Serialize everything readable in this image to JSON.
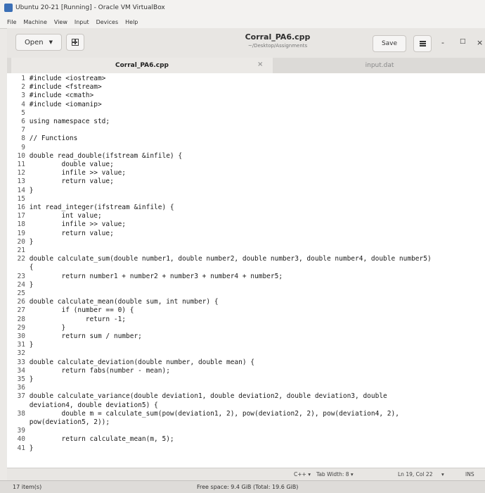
{
  "vbox": {
    "title": "Ubuntu 20-21 [Running] - Oracle VM VirtualBox",
    "menu": [
      "File",
      "Machine",
      "View",
      "Input",
      "Devices",
      "Help"
    ]
  },
  "gedit": {
    "open_label": "Open",
    "doc_title": "Corral_PA6.cpp",
    "doc_path": "~/Desktop/Assignments",
    "save_label": "Save",
    "minimize": "-",
    "maximize": "□",
    "close": "×"
  },
  "tabs": [
    {
      "label": "Corral_PA6.cpp",
      "close": "×"
    },
    {
      "label": "input.dat"
    }
  ],
  "code": [
    {
      "n": "1",
      "t": "#include <iostream>"
    },
    {
      "n": "2",
      "t": "#include <fstream>"
    },
    {
      "n": "3",
      "t": "#include <cmath>"
    },
    {
      "n": "4",
      "t": "#include <iomanip>"
    },
    {
      "n": "5",
      "t": ""
    },
    {
      "n": "6",
      "t": "using namespace std;"
    },
    {
      "n": "7",
      "t": ""
    },
    {
      "n": "8",
      "t": "// Functions"
    },
    {
      "n": "9",
      "t": ""
    },
    {
      "n": "10",
      "t": "double read_double(ifstream &infile) {"
    },
    {
      "n": "11",
      "t": "        double value;"
    },
    {
      "n": "12",
      "t": "        infile >> value;"
    },
    {
      "n": "13",
      "t": "        return value;"
    },
    {
      "n": "14",
      "t": "}"
    },
    {
      "n": "15",
      "t": ""
    },
    {
      "n": "16",
      "t": "int read_integer(ifstream &infile) {"
    },
    {
      "n": "17",
      "t": "        int value;"
    },
    {
      "n": "18",
      "t": "        infile >> value;"
    },
    {
      "n": "19",
      "t": "        return value;"
    },
    {
      "n": "20",
      "t": "}"
    },
    {
      "n": "21",
      "t": ""
    },
    {
      "n": "22",
      "t": "double calculate_sum(double number1, double number2, double number3, double number4, double number5)"
    },
    {
      "n": "",
      "t": "{"
    },
    {
      "n": "23",
      "t": "        return number1 + number2 + number3 + number4 + number5;"
    },
    {
      "n": "24",
      "t": "}"
    },
    {
      "n": "25",
      "t": ""
    },
    {
      "n": "26",
      "t": "double calculate_mean(double sum, int number) {"
    },
    {
      "n": "27",
      "t": "        if (number == 0) {"
    },
    {
      "n": "28",
      "t": "              return -1;"
    },
    {
      "n": "29",
      "t": "        }"
    },
    {
      "n": "30",
      "t": "        return sum / number;"
    },
    {
      "n": "31",
      "t": "}"
    },
    {
      "n": "32",
      "t": ""
    },
    {
      "n": "33",
      "t": "double calculate_deviation(double number, double mean) {"
    },
    {
      "n": "34",
      "t": "        return fabs(number - mean);"
    },
    {
      "n": "35",
      "t": "}"
    },
    {
      "n": "36",
      "t": ""
    },
    {
      "n": "37",
      "t": "double calculate_variance(double deviation1, double deviation2, double deviation3, double"
    },
    {
      "n": "",
      "t": "deviation4, double deviation5) {"
    },
    {
      "n": "38",
      "t": "        double m = calculate_sum(pow(deviation1, 2), pow(deviation2, 2), pow(deviation4, 2),"
    },
    {
      "n": "",
      "t": "pow(deviation5, 2));"
    },
    {
      "n": "39",
      "t": ""
    },
    {
      "n": "40",
      "t": "        return calculate_mean(m, 5);"
    },
    {
      "n": "41",
      "t": "}"
    }
  ],
  "status": {
    "language": "C++ ▾",
    "tab_width": "Tab Width: 8 ▾",
    "position": "Ln 19, Col 22",
    "dropdown": "▾",
    "mode": "INS"
  },
  "bottom": {
    "items": "17 item(s)",
    "free_space": "Free space: 9.4 GiB (Total: 19.6 GiB)"
  }
}
